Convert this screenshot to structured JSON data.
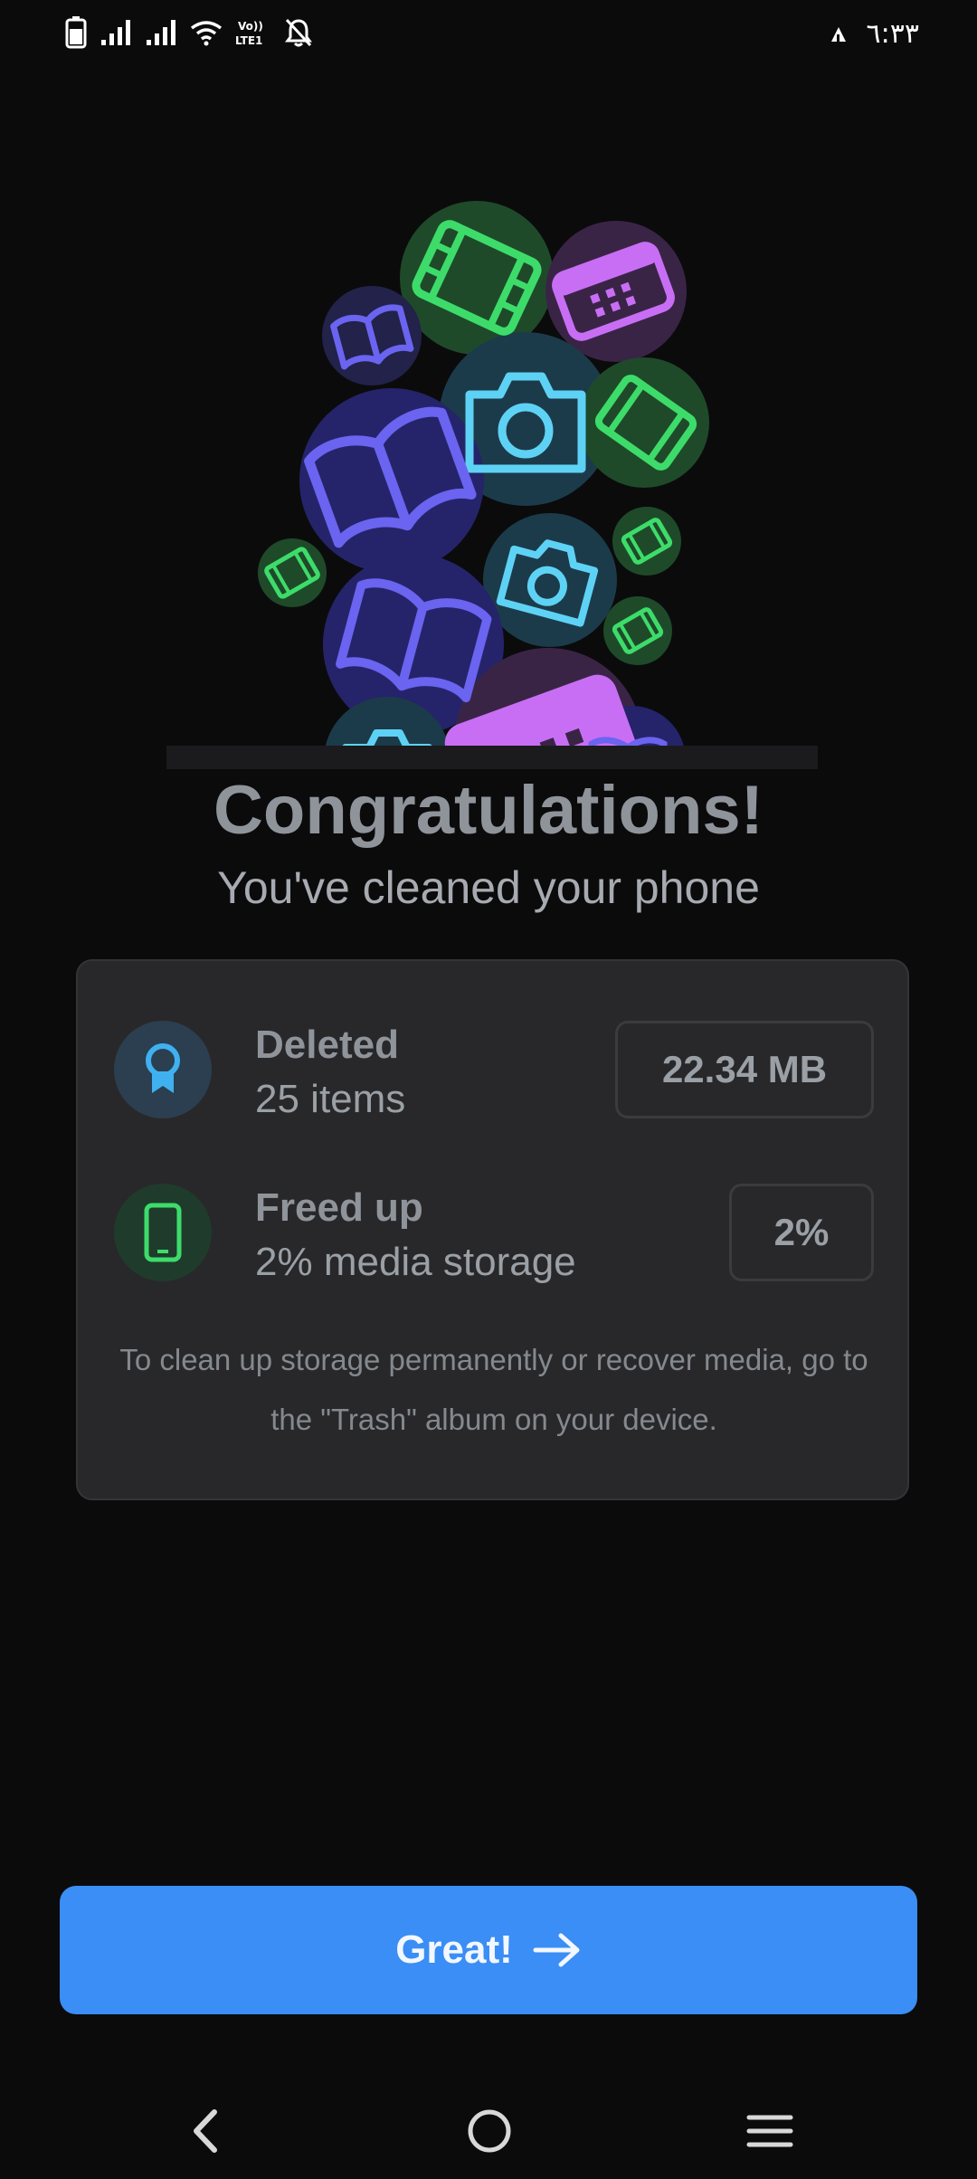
{
  "status_bar": {
    "time": "٦:٣٣",
    "icons": [
      "battery-icon",
      "signal-icon",
      "signal-icon",
      "wifi-icon",
      "volte-icon",
      "bell-off-icon",
      "ai-icon"
    ],
    "volte_text": "Vo LTE1"
  },
  "heading": {
    "title": "Congratulations!",
    "subtitle": "You've cleaned your phone"
  },
  "summary": {
    "deleted": {
      "label": "Deleted",
      "detail": "25 items",
      "value": "22.34 MB",
      "icon": "award-ribbon-icon"
    },
    "freed": {
      "label": "Freed up",
      "detail": "2% media storage",
      "value": "2%",
      "icon": "smartphone-icon"
    },
    "note": "To clean up storage permanently or recover media, go to the \"Trash\" album on your device."
  },
  "cta": {
    "label": "Great!",
    "icon": "arrow-right-icon"
  },
  "nav": {
    "back": "back-icon",
    "home": "home-icon",
    "menu": "menu-icon"
  },
  "colors": {
    "background": "#0b0b0c",
    "card": "#28282a",
    "accent": "#3a8ef5",
    "film_green": "#3ddc6a",
    "calendar_purple": "#c86ef5",
    "camera_cyan": "#5ed2f5",
    "book_indigo": "#6a64f0"
  }
}
